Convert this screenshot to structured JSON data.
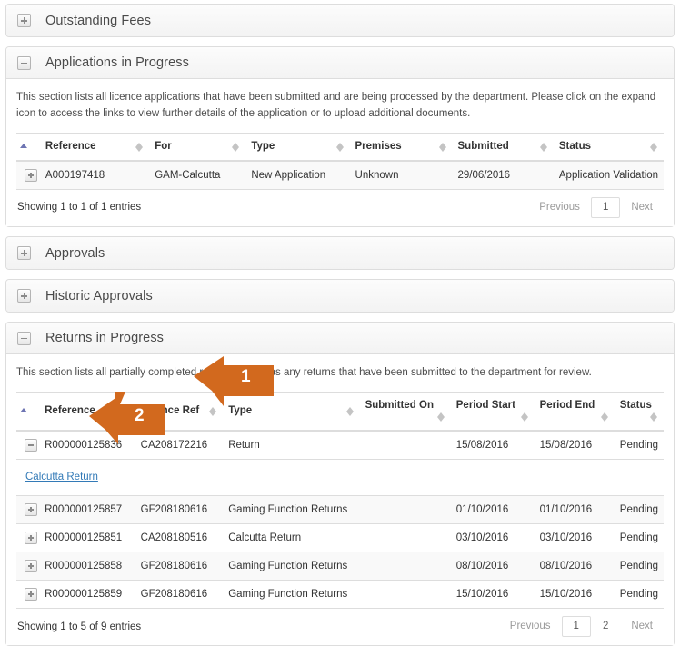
{
  "colors": {
    "accent_orange": "#d2691e",
    "panel_border": "#dddddd",
    "link_blue": "#337ab7",
    "sort_active": "#6e75b3",
    "row_stripe": "#f9f9f9"
  },
  "panels": [
    {
      "id": "outstanding-fees",
      "title": "Outstanding Fees",
      "icon": "plus-square-icon",
      "state": "collapsed"
    },
    {
      "id": "applications-in-progress",
      "title": "Applications in Progress",
      "icon": "minus-square-icon",
      "state": "expanded"
    },
    {
      "id": "approvals",
      "title": "Approvals",
      "icon": "plus-square-icon",
      "state": "collapsed"
    },
    {
      "id": "historic-approvals",
      "title": "Historic Approvals",
      "icon": "plus-square-icon",
      "state": "collapsed"
    },
    {
      "id": "returns-in-progress",
      "title": "Returns in Progress",
      "icon": "minus-square-icon",
      "state": "expanded"
    }
  ],
  "applications": {
    "description": "This section lists all licence applications that have been submitted and are being processed by the department. Please click on the expand icon to access the links to view further details of the application or to upload additional documents.",
    "columns": [
      {
        "label": "Reference",
        "sort": "asc"
      },
      {
        "label": "For",
        "sort": "none"
      },
      {
        "label": "Type",
        "sort": "none"
      },
      {
        "label": "Premises",
        "sort": "none"
      },
      {
        "label": "Submitted",
        "sort": "none"
      },
      {
        "label": "Status",
        "sort": "none"
      }
    ],
    "rows": [
      {
        "expand_icon": "plus-square-icon",
        "reference": "A000197418",
        "for": "GAM-Calcutta",
        "type": "New Application",
        "premises": "Unknown",
        "submitted": "29/06/2016",
        "status": "Application Validation"
      }
    ],
    "info": "Showing 1 to 1 of 1 entries",
    "pagination": {
      "previous": "Previous",
      "pages": [
        "1"
      ],
      "active_page": "1",
      "next": "Next"
    }
  },
  "returns": {
    "description": "This section lists all partially completed returns as well as any returns that have been submitted to the department for review.",
    "columns": [
      {
        "label": "Reference",
        "sort": "asc"
      },
      {
        "label": "Licence Ref",
        "sort": "none"
      },
      {
        "label": "Type",
        "sort": "none"
      },
      {
        "label": "Submitted On",
        "sort": "none"
      },
      {
        "label": "Period Start",
        "sort": "none"
      },
      {
        "label": "Period End",
        "sort": "none"
      },
      {
        "label": "Status",
        "sort": "none"
      }
    ],
    "rows": [
      {
        "expand_icon": "minus-square-icon",
        "reference": "R000000125836",
        "licence_ref": "CA208172216",
        "type": "Return",
        "submitted_on": "",
        "period_start": "15/08/2016",
        "period_end": "15/08/2016",
        "status": "Pending"
      },
      {
        "expand_icon": "plus-square-icon",
        "reference": "R000000125857",
        "licence_ref": "GF208180616",
        "type": "Gaming Function Returns",
        "submitted_on": "",
        "period_start": "01/10/2016",
        "period_end": "01/10/2016",
        "status": "Pending"
      },
      {
        "expand_icon": "plus-square-icon",
        "reference": "R000000125851",
        "licence_ref": "CA208180516",
        "type": "Calcutta Return",
        "submitted_on": "",
        "period_start": "03/10/2016",
        "period_end": "03/10/2016",
        "status": "Pending"
      },
      {
        "expand_icon": "plus-square-icon",
        "reference": "R000000125858",
        "licence_ref": "GF208180616",
        "type": "Gaming Function Returns",
        "submitted_on": "",
        "period_start": "08/10/2016",
        "period_end": "08/10/2016",
        "status": "Pending"
      },
      {
        "expand_icon": "plus-square-icon",
        "reference": "R000000125859",
        "licence_ref": "GF208180616",
        "type": "Gaming Function Returns",
        "submitted_on": "",
        "period_start": "15/10/2016",
        "period_end": "15/10/2016",
        "status": "Pending"
      }
    ],
    "detail_row": {
      "link_label": "Calcutta Return"
    },
    "info": "Showing 1 to 5 of 9 entries",
    "pagination": {
      "previous": "Previous",
      "pages": [
        "1",
        "2"
      ],
      "active_page": "1",
      "next": "Next"
    }
  },
  "annotations": [
    {
      "id": "annotation-1",
      "label": "1"
    },
    {
      "id": "annotation-2",
      "label": "2"
    }
  ]
}
